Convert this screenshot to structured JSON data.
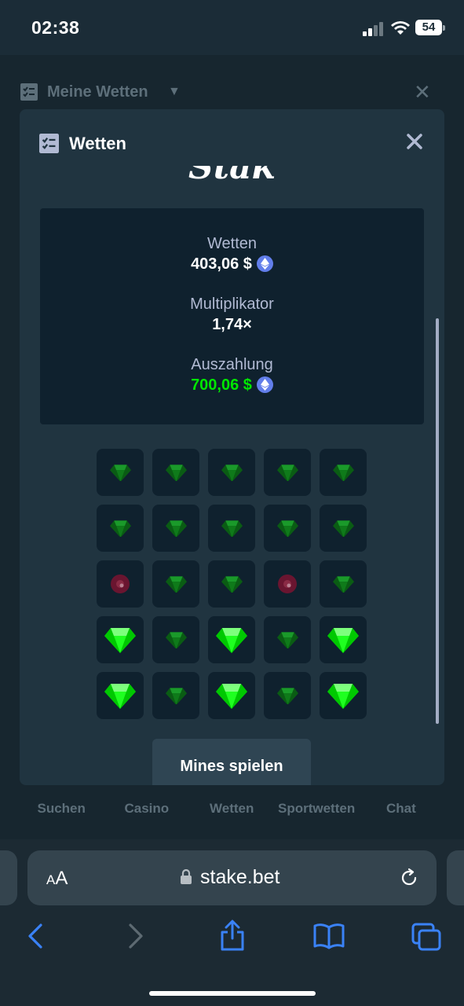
{
  "status": {
    "time": "02:38",
    "battery": "54"
  },
  "bg_header": {
    "title": "Meine Wetten"
  },
  "modal": {
    "title": "Wetten",
    "logo": "Stake",
    "summary": {
      "bet_label": "Wetten",
      "bet_value": "403,06 $",
      "mult_label": "Multiplikator",
      "mult_value": "1,74×",
      "payout_label": "Auszahlung",
      "payout_value": "700,06 $"
    },
    "play_button": "Mines spielen",
    "grid": [
      [
        "gem",
        "gem",
        "gem",
        "gem",
        "gem"
      ],
      [
        "gem",
        "gem",
        "gem",
        "gem",
        "gem"
      ],
      [
        "mine",
        "gem",
        "gem",
        "mine",
        "gem"
      ],
      [
        "gem-revealed",
        "gem",
        "gem-revealed",
        "gem",
        "gem-revealed"
      ],
      [
        "gem-revealed",
        "gem",
        "gem-revealed",
        "gem",
        "gem-revealed"
      ]
    ]
  },
  "site_nav": [
    {
      "label": "Suchen",
      "icon": "search-icon"
    },
    {
      "label": "Casino",
      "icon": "cards-icon"
    },
    {
      "label": "Wetten",
      "icon": "bets-icon"
    },
    {
      "label": "Sportwetten",
      "icon": "sports-icon"
    },
    {
      "label": "Chat",
      "icon": "chat-icon"
    }
  ],
  "safari": {
    "aa": "AA",
    "url": "stake.bet"
  },
  "colors": {
    "accent_green": "#00e701",
    "modal_bg": "#203440",
    "panel_bg": "#0f212e",
    "eth": "#627eea"
  }
}
